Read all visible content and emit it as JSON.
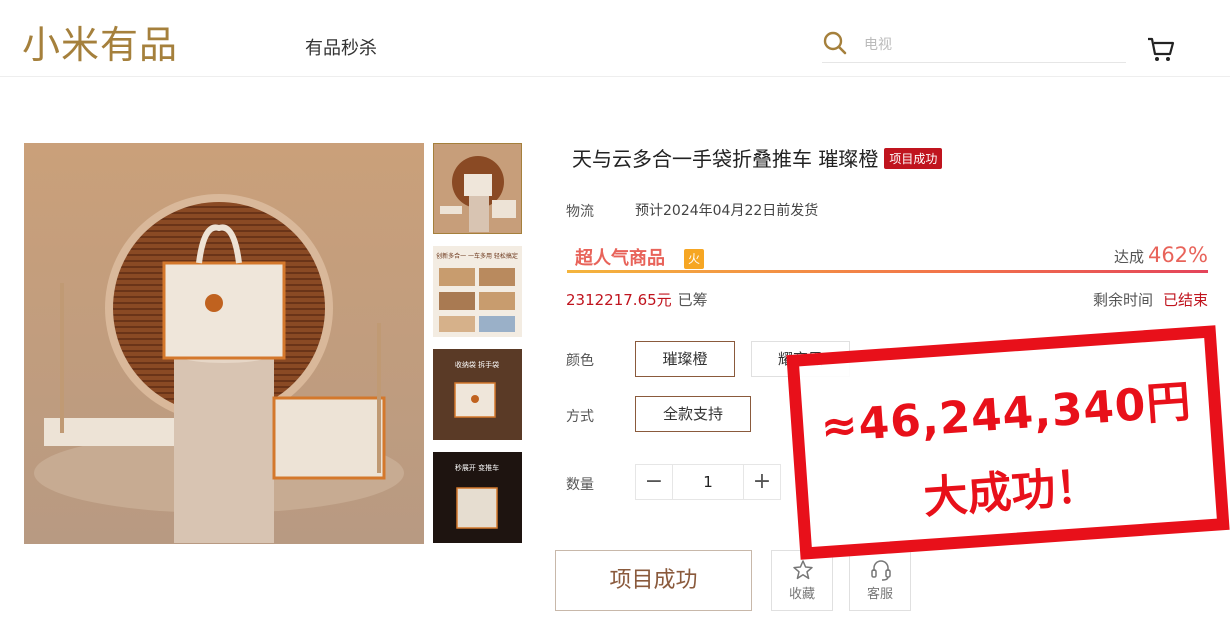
{
  "header": {
    "logo": "小米有品",
    "nav_flash_sale": "有品秒杀",
    "search_placeholder": "电视"
  },
  "product": {
    "title": "天与云多合一手袋折叠推车 璀璨橙",
    "title_badge": "项目成功",
    "shipping_label": "物流",
    "shipping_text": "预计2024年04月22日前发货",
    "hot_label": "超人气商品",
    "hot_icon_text": "火",
    "achieve_label": "达成",
    "achieve_percent": "462%",
    "funds_amount": "2312217.65元",
    "funds_suffix": "已筹",
    "remain_label": "剩余时间",
    "remain_value": "已结束",
    "color_label": "颜色",
    "colors": [
      "璀璨橙",
      "耀夜黑"
    ],
    "selected_color": "璀璨橙",
    "method_label": "方式",
    "method_option": "全款支持",
    "qty_label": "数量",
    "qty_value": "1",
    "qty_minus": "−",
    "qty_plus": "+",
    "buy_button": "项目成功",
    "favorite_label": "收藏",
    "service_label": "客服"
  },
  "thumbnails": [
    {
      "caption": ""
    },
    {
      "caption_line1": "创新多合一 一车多用 轻松搞定"
    },
    {
      "caption_line1": "收纳袋 拆手袋"
    },
    {
      "caption_line1": "秒展开 变推车"
    }
  ],
  "stamp": {
    "amount": "≈46,244,340円",
    "success": "大成功！"
  },
  "colors": {
    "brand_gold": "#a5803c",
    "accent_red": "#c0141e",
    "stamp_red": "#e8101a",
    "selected_border": "#8a5a3c"
  }
}
